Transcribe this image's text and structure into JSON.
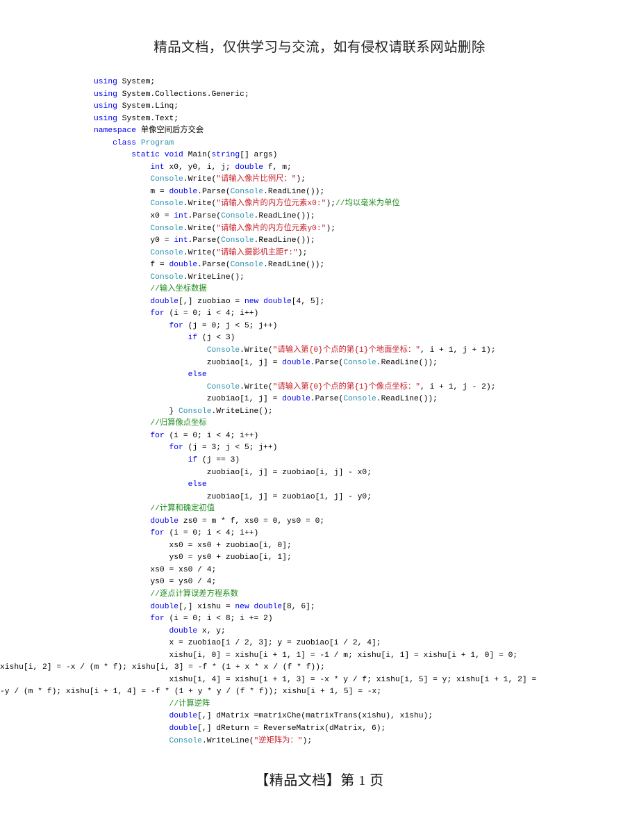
{
  "document": {
    "header_banner": "精品文档，仅供学习与交流，如有侵权请联系网站删除",
    "footer": "【精品文档】第 1 页",
    "page_number": "1",
    "language": "C#",
    "colors": {
      "keyword": "#0000EE",
      "type": "#2B91AF",
      "string": "#C8202B",
      "comment": "#1E8B1E",
      "plain": "#000000",
      "background": "#FFFFFF"
    }
  },
  "code": {
    "lines": [
      {
        "indent": 0,
        "wrap": false,
        "tokens": [
          {
            "t": "using",
            "c": "kw"
          },
          {
            "t": " System;",
            "c": "txt"
          }
        ]
      },
      {
        "indent": 0,
        "wrap": false,
        "tokens": [
          {
            "t": "using",
            "c": "kw"
          },
          {
            "t": " System.Collections.Generic;",
            "c": "txt"
          }
        ]
      },
      {
        "indent": 0,
        "wrap": false,
        "tokens": [
          {
            "t": "using",
            "c": "kw"
          },
          {
            "t": " System.Linq;",
            "c": "txt"
          }
        ]
      },
      {
        "indent": 0,
        "wrap": false,
        "tokens": [
          {
            "t": "using",
            "c": "kw"
          },
          {
            "t": " System.Text;",
            "c": "txt"
          }
        ]
      },
      {
        "indent": 0,
        "wrap": false,
        "tokens": [
          {
            "t": "namespace",
            "c": "kw"
          },
          {
            "t": " 单像空间后方交会",
            "c": "txt"
          }
        ]
      },
      {
        "indent": 1,
        "wrap": false,
        "tokens": [
          {
            "t": "class",
            "c": "kw"
          },
          {
            "t": " ",
            "c": "txt"
          },
          {
            "t": "Program",
            "c": "type"
          }
        ]
      },
      {
        "indent": 2,
        "wrap": false,
        "tokens": [
          {
            "t": "static",
            "c": "kw"
          },
          {
            "t": " ",
            "c": "txt"
          },
          {
            "t": "void",
            "c": "kw"
          },
          {
            "t": " Main(",
            "c": "txt"
          },
          {
            "t": "string",
            "c": "kw"
          },
          {
            "t": "[] args)",
            "c": "txt"
          }
        ]
      },
      {
        "indent": 3,
        "wrap": false,
        "tokens": [
          {
            "t": "int",
            "c": "kw"
          },
          {
            "t": " x0, y0, i, j; ",
            "c": "txt"
          },
          {
            "t": "double",
            "c": "kw"
          },
          {
            "t": " f, m;",
            "c": "txt"
          }
        ]
      },
      {
        "indent": 3,
        "wrap": false,
        "tokens": [
          {
            "t": "Console",
            "c": "type"
          },
          {
            "t": ".Write(",
            "c": "txt"
          },
          {
            "t": "\"请输入像片比例尺：\"",
            "c": "str"
          },
          {
            "t": ");",
            "c": "txt"
          }
        ]
      },
      {
        "indent": 3,
        "wrap": false,
        "tokens": [
          {
            "t": "m = ",
            "c": "txt"
          },
          {
            "t": "double",
            "c": "kw"
          },
          {
            "t": ".Parse(",
            "c": "txt"
          },
          {
            "t": "Console",
            "c": "type"
          },
          {
            "t": ".ReadLine());",
            "c": "txt"
          }
        ]
      },
      {
        "indent": 3,
        "wrap": false,
        "tokens": [
          {
            "t": "Console",
            "c": "type"
          },
          {
            "t": ".Write(",
            "c": "txt"
          },
          {
            "t": "\"请输入像片的内方位元素x0:\"",
            "c": "str"
          },
          {
            "t": ");",
            "c": "txt"
          },
          {
            "t": "//均以毫米为单位",
            "c": "cmt"
          }
        ]
      },
      {
        "indent": 3,
        "wrap": false,
        "tokens": [
          {
            "t": "x0 = ",
            "c": "txt"
          },
          {
            "t": "int",
            "c": "kw"
          },
          {
            "t": ".Parse(",
            "c": "txt"
          },
          {
            "t": "Console",
            "c": "type"
          },
          {
            "t": ".ReadLine());",
            "c": "txt"
          }
        ]
      },
      {
        "indent": 3,
        "wrap": false,
        "tokens": [
          {
            "t": "Console",
            "c": "type"
          },
          {
            "t": ".Write(",
            "c": "txt"
          },
          {
            "t": "\"请输入像片的内方位元素y0:\"",
            "c": "str"
          },
          {
            "t": ");",
            "c": "txt"
          }
        ]
      },
      {
        "indent": 3,
        "wrap": false,
        "tokens": [
          {
            "t": "y0 = ",
            "c": "txt"
          },
          {
            "t": "int",
            "c": "kw"
          },
          {
            "t": ".Parse(",
            "c": "txt"
          },
          {
            "t": "Console",
            "c": "type"
          },
          {
            "t": ".ReadLine());",
            "c": "txt"
          }
        ]
      },
      {
        "indent": 3,
        "wrap": false,
        "tokens": [
          {
            "t": "Console",
            "c": "type"
          },
          {
            "t": ".Write(",
            "c": "txt"
          },
          {
            "t": "\"请输入摄影机主距f:\"",
            "c": "str"
          },
          {
            "t": ");",
            "c": "txt"
          }
        ]
      },
      {
        "indent": 3,
        "wrap": false,
        "tokens": [
          {
            "t": "f = ",
            "c": "txt"
          },
          {
            "t": "double",
            "c": "kw"
          },
          {
            "t": ".Parse(",
            "c": "txt"
          },
          {
            "t": "Console",
            "c": "type"
          },
          {
            "t": ".ReadLine());",
            "c": "txt"
          }
        ]
      },
      {
        "indent": 3,
        "wrap": false,
        "tokens": [
          {
            "t": "Console",
            "c": "type"
          },
          {
            "t": ".WriteLine();",
            "c": "txt"
          }
        ]
      },
      {
        "indent": 3,
        "wrap": false,
        "tokens": [
          {
            "t": "//输入坐标数据",
            "c": "cmt"
          }
        ]
      },
      {
        "indent": 3,
        "wrap": false,
        "tokens": [
          {
            "t": "double",
            "c": "kw"
          },
          {
            "t": "[,] zuobiao = ",
            "c": "txt"
          },
          {
            "t": "new",
            "c": "kw"
          },
          {
            "t": " ",
            "c": "txt"
          },
          {
            "t": "double",
            "c": "kw"
          },
          {
            "t": "[4, 5];",
            "c": "txt"
          }
        ]
      },
      {
        "indent": 3,
        "wrap": false,
        "tokens": [
          {
            "t": "for",
            "c": "kw"
          },
          {
            "t": " (i = 0; i < 4; i++)",
            "c": "txt"
          }
        ]
      },
      {
        "indent": 4,
        "wrap": false,
        "tokens": [
          {
            "t": "for",
            "c": "kw"
          },
          {
            "t": " (j = 0; j < 5; j++)",
            "c": "txt"
          }
        ]
      },
      {
        "indent": 5,
        "wrap": false,
        "tokens": [
          {
            "t": "if",
            "c": "kw"
          },
          {
            "t": " (j < 3)",
            "c": "txt"
          }
        ]
      },
      {
        "indent": 6,
        "wrap": false,
        "tokens": [
          {
            "t": "Console",
            "c": "type"
          },
          {
            "t": ".Write(",
            "c": "txt"
          },
          {
            "t": "\"请输入第{0}个点的第{1}个地面坐标：\"",
            "c": "str"
          },
          {
            "t": ", i + 1, j + 1);",
            "c": "txt"
          }
        ]
      },
      {
        "indent": 6,
        "wrap": false,
        "tokens": [
          {
            "t": "zuobiao[i, j] = ",
            "c": "txt"
          },
          {
            "t": "double",
            "c": "kw"
          },
          {
            "t": ".Parse(",
            "c": "txt"
          },
          {
            "t": "Console",
            "c": "type"
          },
          {
            "t": ".ReadLine());",
            "c": "txt"
          }
        ]
      },
      {
        "indent": 5,
        "wrap": false,
        "tokens": [
          {
            "t": "else",
            "c": "kw"
          }
        ]
      },
      {
        "indent": 6,
        "wrap": false,
        "tokens": [
          {
            "t": "Console",
            "c": "type"
          },
          {
            "t": ".Write(",
            "c": "txt"
          },
          {
            "t": "\"请输入第{0}个点的第{1}个像点坐标：\"",
            "c": "str"
          },
          {
            "t": ", i + 1, j - 2);",
            "c": "txt"
          }
        ]
      },
      {
        "indent": 6,
        "wrap": false,
        "tokens": [
          {
            "t": "zuobiao[i, j] = ",
            "c": "txt"
          },
          {
            "t": "double",
            "c": "kw"
          },
          {
            "t": ".Parse(",
            "c": "txt"
          },
          {
            "t": "Console",
            "c": "type"
          },
          {
            "t": ".ReadLine());",
            "c": "txt"
          }
        ]
      },
      {
        "indent": 4,
        "wrap": false,
        "tokens": [
          {
            "t": "} ",
            "c": "txt"
          },
          {
            "t": "Console",
            "c": "type"
          },
          {
            "t": ".WriteLine();",
            "c": "txt"
          }
        ]
      },
      {
        "indent": 3,
        "wrap": false,
        "tokens": [
          {
            "t": "//归算像点坐标",
            "c": "cmt"
          }
        ]
      },
      {
        "indent": 3,
        "wrap": false,
        "tokens": [
          {
            "t": "for",
            "c": "kw"
          },
          {
            "t": " (i = 0; i < 4; i++)",
            "c": "txt"
          }
        ]
      },
      {
        "indent": 4,
        "wrap": false,
        "tokens": [
          {
            "t": "for",
            "c": "kw"
          },
          {
            "t": " (j = 3; j < 5; j++)",
            "c": "txt"
          }
        ]
      },
      {
        "indent": 5,
        "wrap": false,
        "tokens": [
          {
            "t": "if",
            "c": "kw"
          },
          {
            "t": " (j == 3)",
            "c": "txt"
          }
        ]
      },
      {
        "indent": 6,
        "wrap": false,
        "tokens": [
          {
            "t": "zuobiao[i, j] = zuobiao[i, j] - x0;",
            "c": "txt"
          }
        ]
      },
      {
        "indent": 5,
        "wrap": false,
        "tokens": [
          {
            "t": "else",
            "c": "kw"
          }
        ]
      },
      {
        "indent": 6,
        "wrap": false,
        "tokens": [
          {
            "t": "zuobiao[i, j] = zuobiao[i, j] - y0;",
            "c": "txt"
          }
        ]
      },
      {
        "indent": 3,
        "wrap": false,
        "tokens": [
          {
            "t": "//计算和确定初值",
            "c": "cmt"
          }
        ]
      },
      {
        "indent": 3,
        "wrap": false,
        "tokens": [
          {
            "t": "double",
            "c": "kw"
          },
          {
            "t": " zs0 = m * f, xs0 = 0, ys0 = 0;",
            "c": "txt"
          }
        ]
      },
      {
        "indent": 3,
        "wrap": false,
        "tokens": [
          {
            "t": "for",
            "c": "kw"
          },
          {
            "t": " (i = 0; i < 4; i++)",
            "c": "txt"
          }
        ]
      },
      {
        "indent": 4,
        "wrap": false,
        "tokens": [
          {
            "t": "xs0 = xs0 + zuobiao[i, 0];",
            "c": "txt"
          }
        ]
      },
      {
        "indent": 4,
        "wrap": false,
        "tokens": [
          {
            "t": "ys0 = ys0 + zuobiao[i, 1];",
            "c": "txt"
          }
        ]
      },
      {
        "indent": 3,
        "wrap": false,
        "tokens": [
          {
            "t": "xs0 = xs0 / 4;",
            "c": "txt"
          }
        ]
      },
      {
        "indent": 3,
        "wrap": false,
        "tokens": [
          {
            "t": "ys0 = ys0 / 4;",
            "c": "txt"
          }
        ]
      },
      {
        "indent": 3,
        "wrap": false,
        "tokens": [
          {
            "t": "//逐点计算误差方程系数",
            "c": "cmt"
          }
        ]
      },
      {
        "indent": 3,
        "wrap": false,
        "tokens": [
          {
            "t": "double",
            "c": "kw"
          },
          {
            "t": "[,] xishu = ",
            "c": "txt"
          },
          {
            "t": "new",
            "c": "kw"
          },
          {
            "t": " ",
            "c": "txt"
          },
          {
            "t": "double",
            "c": "kw"
          },
          {
            "t": "[8, 6];",
            "c": "txt"
          }
        ]
      },
      {
        "indent": 3,
        "wrap": false,
        "tokens": [
          {
            "t": "for",
            "c": "kw"
          },
          {
            "t": " (i = 0; i < 8; i += 2)",
            "c": "txt"
          }
        ]
      },
      {
        "indent": 4,
        "wrap": false,
        "tokens": [
          {
            "t": "double",
            "c": "kw"
          },
          {
            "t": " x, y;",
            "c": "txt"
          }
        ]
      },
      {
        "indent": 4,
        "wrap": false,
        "tokens": [
          {
            "t": "x = zuobiao[i / 2, 3]; y = zuobiao[i / 2, 4];",
            "c": "txt"
          }
        ]
      },
      {
        "indent": 4,
        "wrap": false,
        "tokens": [
          {
            "t": "xishu[i, 0] = xishu[i + 1, 1] = -1 / m; xishu[i, 1] = xishu[i + 1, 0] = 0;",
            "c": "txt"
          }
        ]
      },
      {
        "indent": 0,
        "wrap": true,
        "tokens": [
          {
            "t": "xishu[i, 2] = -x / (m * f); xishu[i, 3] = -f * (1 + x * x / (f * f));",
            "c": "txt"
          }
        ]
      },
      {
        "indent": 4,
        "wrap": false,
        "tokens": [
          {
            "t": "xishu[i, 4] = xishu[i + 1, 3] = -x * y / f; xishu[i, 5] = y; xishu[i + 1, 2] =",
            "c": "txt"
          }
        ]
      },
      {
        "indent": 0,
        "wrap": true,
        "tokens": [
          {
            "t": "-y / (m * f); xishu[i + 1, 4] = -f * (1 + y * y / (f * f)); xishu[i + 1, 5] = -x;",
            "c": "txt"
          }
        ]
      },
      {
        "indent": 4,
        "wrap": false,
        "tokens": [
          {
            "t": "//计算逆阵",
            "c": "cmt"
          }
        ]
      },
      {
        "indent": 4,
        "wrap": false,
        "tokens": [
          {
            "t": "double",
            "c": "kw"
          },
          {
            "t": "[,] dMatrix =matrixChe(matrixTrans(xishu), xishu);",
            "c": "txt"
          }
        ]
      },
      {
        "indent": 4,
        "wrap": false,
        "tokens": [
          {
            "t": "double",
            "c": "kw"
          },
          {
            "t": "[,] dReturn = ReverseMatrix(dMatrix, 6);",
            "c": "txt"
          }
        ]
      },
      {
        "indent": 4,
        "wrap": false,
        "tokens": [
          {
            "t": "Console",
            "c": "type"
          },
          {
            "t": ".WriteLine(",
            "c": "txt"
          },
          {
            "t": "\"逆矩阵为：\"",
            "c": "str"
          },
          {
            "t": ");",
            "c": "txt"
          }
        ]
      }
    ]
  }
}
